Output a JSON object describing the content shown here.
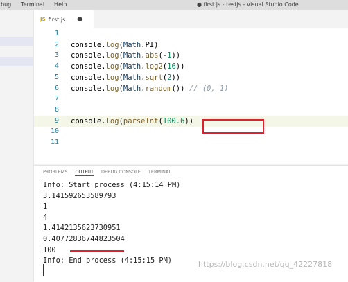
{
  "titlebar": {
    "menu": [
      "bug",
      "Terminal",
      "Help"
    ],
    "window_title": "● first.js - testjs - Visual Studio Code"
  },
  "tab": {
    "icon_label": "JS",
    "filename": "first.js",
    "modified_marker": "●"
  },
  "editor": {
    "line_numbers": [
      "1",
      "2",
      "3",
      "4",
      "5",
      "6",
      "7",
      "8",
      "9",
      "10",
      "11"
    ],
    "code_lines": [
      "",
      "console.log(Math.PI)",
      "console.log(Math.abs(-1))",
      "console.log(Math.log2(16))",
      "console.log(Math.sqrt(2))",
      "console.log(Math.random()) // (0, 1)",
      "",
      "",
      "console.log(parseInt(100.6))",
      "",
      ""
    ],
    "highlighted_line": "9"
  },
  "panel": {
    "tabs": [
      "PROBLEMS",
      "OUTPUT",
      "DEBUG CONSOLE",
      "TERMINAL"
    ],
    "active_tab": "OUTPUT",
    "output_lines": [
      "Info: Start process (4:15:14 PM)",
      "3.141592653589793",
      "1",
      "4",
      "1.4142135623730951",
      "0.40772836744823504",
      "100",
      "Info: End process (4:15:15 PM)"
    ]
  },
  "watermark": "https://blog.csdn.net/qq_42227818",
  "colors": {
    "annotation_red": "#e0202a",
    "line_number": "#237893"
  }
}
